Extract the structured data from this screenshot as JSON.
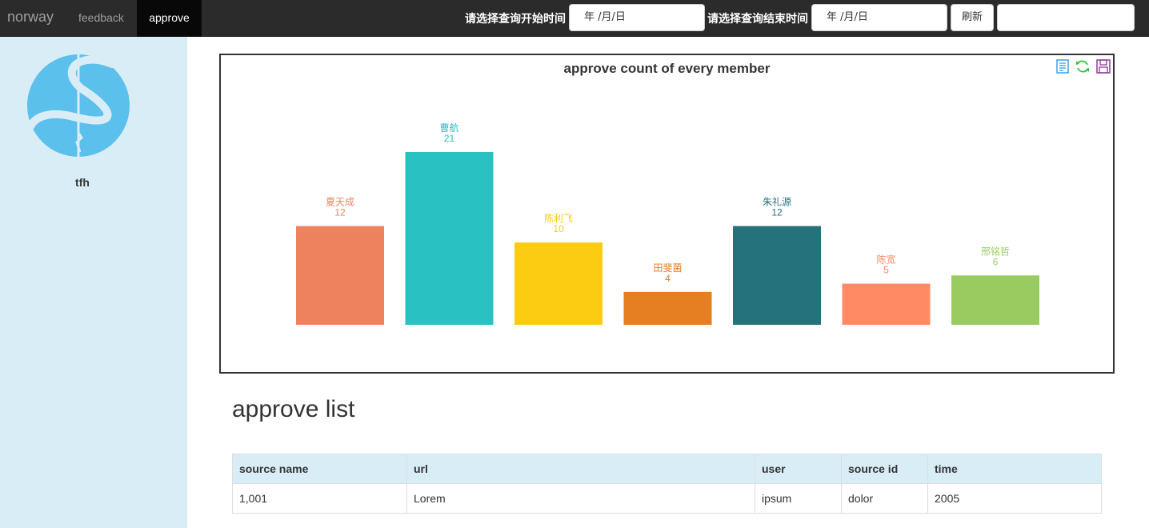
{
  "navbar": {
    "brand": "norway",
    "links": [
      {
        "label": "feedback"
      },
      {
        "label": "approve"
      }
    ],
    "start_label": "请选择查询开始时间",
    "start_placeholder": "年 /月/日",
    "end_label": "请选择查询结束时间",
    "end_placeholder": "年 /月/日",
    "refresh_label": "刷新",
    "search_value": ""
  },
  "sidebar": {
    "username": "tfh"
  },
  "chart_data": {
    "type": "bar",
    "title": "approve count of every member",
    "categories": [
      "夏天成",
      "曹航",
      "陈利飞",
      "田斐菌",
      "朱礼源",
      "陈宽",
      "邢铭哲"
    ],
    "values": [
      12,
      21,
      10,
      4,
      12,
      5,
      6
    ],
    "colors": [
      "#ef825e",
      "#29c1c2",
      "#fbcc11",
      "#e67e22",
      "#26727c",
      "#ff8a64",
      "#9acb61"
    ],
    "grid": false,
    "toolbox_icons": [
      "data-view-icon",
      "restore-icon",
      "save-image-icon"
    ],
    "toolbox_colors": [
      "#3c9fe2",
      "#2ec43c",
      "#8e3a9a"
    ]
  },
  "table": {
    "title": "approve list",
    "headers": [
      "source name",
      "url",
      "user",
      "source id",
      "time"
    ],
    "rows": [
      [
        "1,001",
        "Lorem",
        "ipsum",
        "dolor",
        "2005"
      ]
    ]
  }
}
